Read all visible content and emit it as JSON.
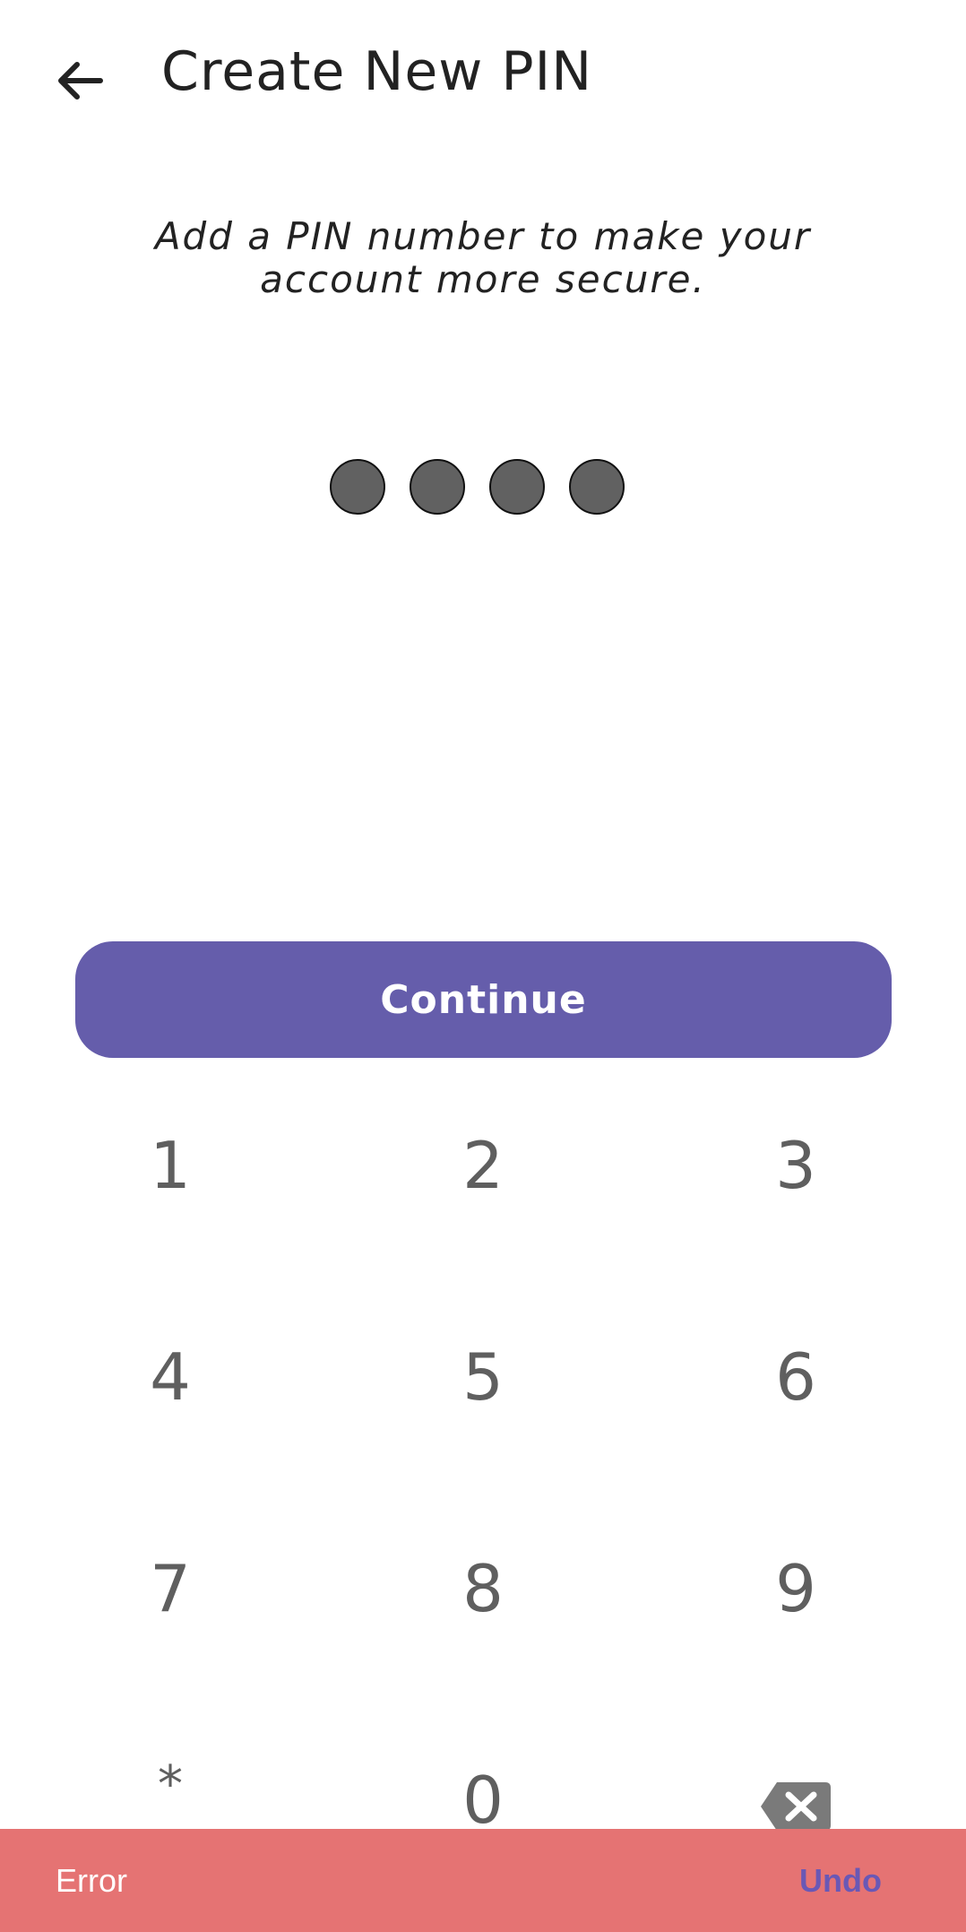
{
  "header": {
    "title": "Create New PIN",
    "back_icon": "arrow-left-icon"
  },
  "subtitle": "Add a PIN number to make your account more secure.",
  "pin": {
    "length": 4,
    "filled": 4
  },
  "continue_label": "Continue",
  "keypad": {
    "k1": "1",
    "k2": "2",
    "k3": "3",
    "k4": "4",
    "k5": "5",
    "k6": "6",
    "k7": "7",
    "k8": "8",
    "k9": "9",
    "star": "*",
    "k0": "0",
    "backspace_icon": "backspace-icon"
  },
  "snackbar": {
    "message": "Error",
    "action": "Undo"
  },
  "colors": {
    "accent": "#655dab",
    "snackbar_bg": "#e57373",
    "snackbar_action": "#6a58b5",
    "pin_dot": "#616161",
    "key_text": "#5f5f5f"
  }
}
